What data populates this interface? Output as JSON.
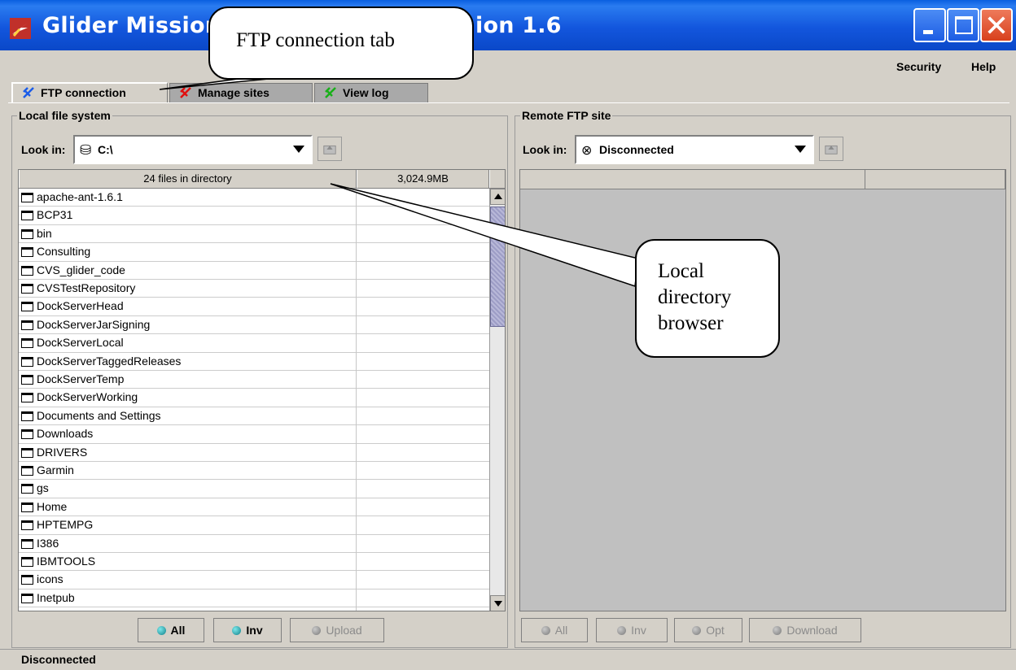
{
  "window": {
    "title": "Glider Mission",
    "title_right": "ion 1.6",
    "title_bar_color": "#1356dd",
    "close_color": "#d8401c"
  },
  "menu": {
    "items": [
      "Security",
      "Help"
    ]
  },
  "tabs": [
    {
      "label": "FTP connection",
      "icon": "plug-icon",
      "color": "#1a5ce8",
      "active": true
    },
    {
      "label": "Manage sites",
      "icon": "plug-icon",
      "color": "#e01010",
      "active": false
    },
    {
      "label": "View log",
      "icon": "plug-icon",
      "color": "#18b018",
      "active": false
    }
  ],
  "local": {
    "title": "Local file system",
    "look_in_label": "Look in:",
    "look_in_value": "C:\\",
    "header": {
      "name_col": "24 files in directory",
      "size_col": "3,024.9MB"
    },
    "files": [
      "apache-ant-1.6.1",
      "BCP31",
      "bin",
      "Consulting",
      "CVS_glider_code",
      "CVSTestRepository",
      "DockServerHead",
      "DockServerJarSigning",
      "DockServerLocal",
      "DockServerTaggedReleases",
      "DockServerTemp",
      "DockServerWorking",
      "Documents and Settings",
      "Downloads",
      "DRIVERS",
      "Garmin",
      "gs",
      "Home",
      "HPTEMPG",
      "I386",
      "IBMTOOLS",
      "icons",
      "Inetpub"
    ],
    "buttons": {
      "all": "All",
      "inv": "Inv",
      "upload": "Upload"
    }
  },
  "remote": {
    "title": "Remote FTP site",
    "look_in_label": "Look in:",
    "look_in_value": "Disconnected",
    "buttons": {
      "all": "All",
      "inv": "Inv",
      "opt": "Opt",
      "download": "Download"
    }
  },
  "status": {
    "text": "Disconnected"
  },
  "callouts": {
    "ftp_tab": "FTP connection tab",
    "local_browser": [
      "Local",
      "directory",
      "browser"
    ]
  }
}
